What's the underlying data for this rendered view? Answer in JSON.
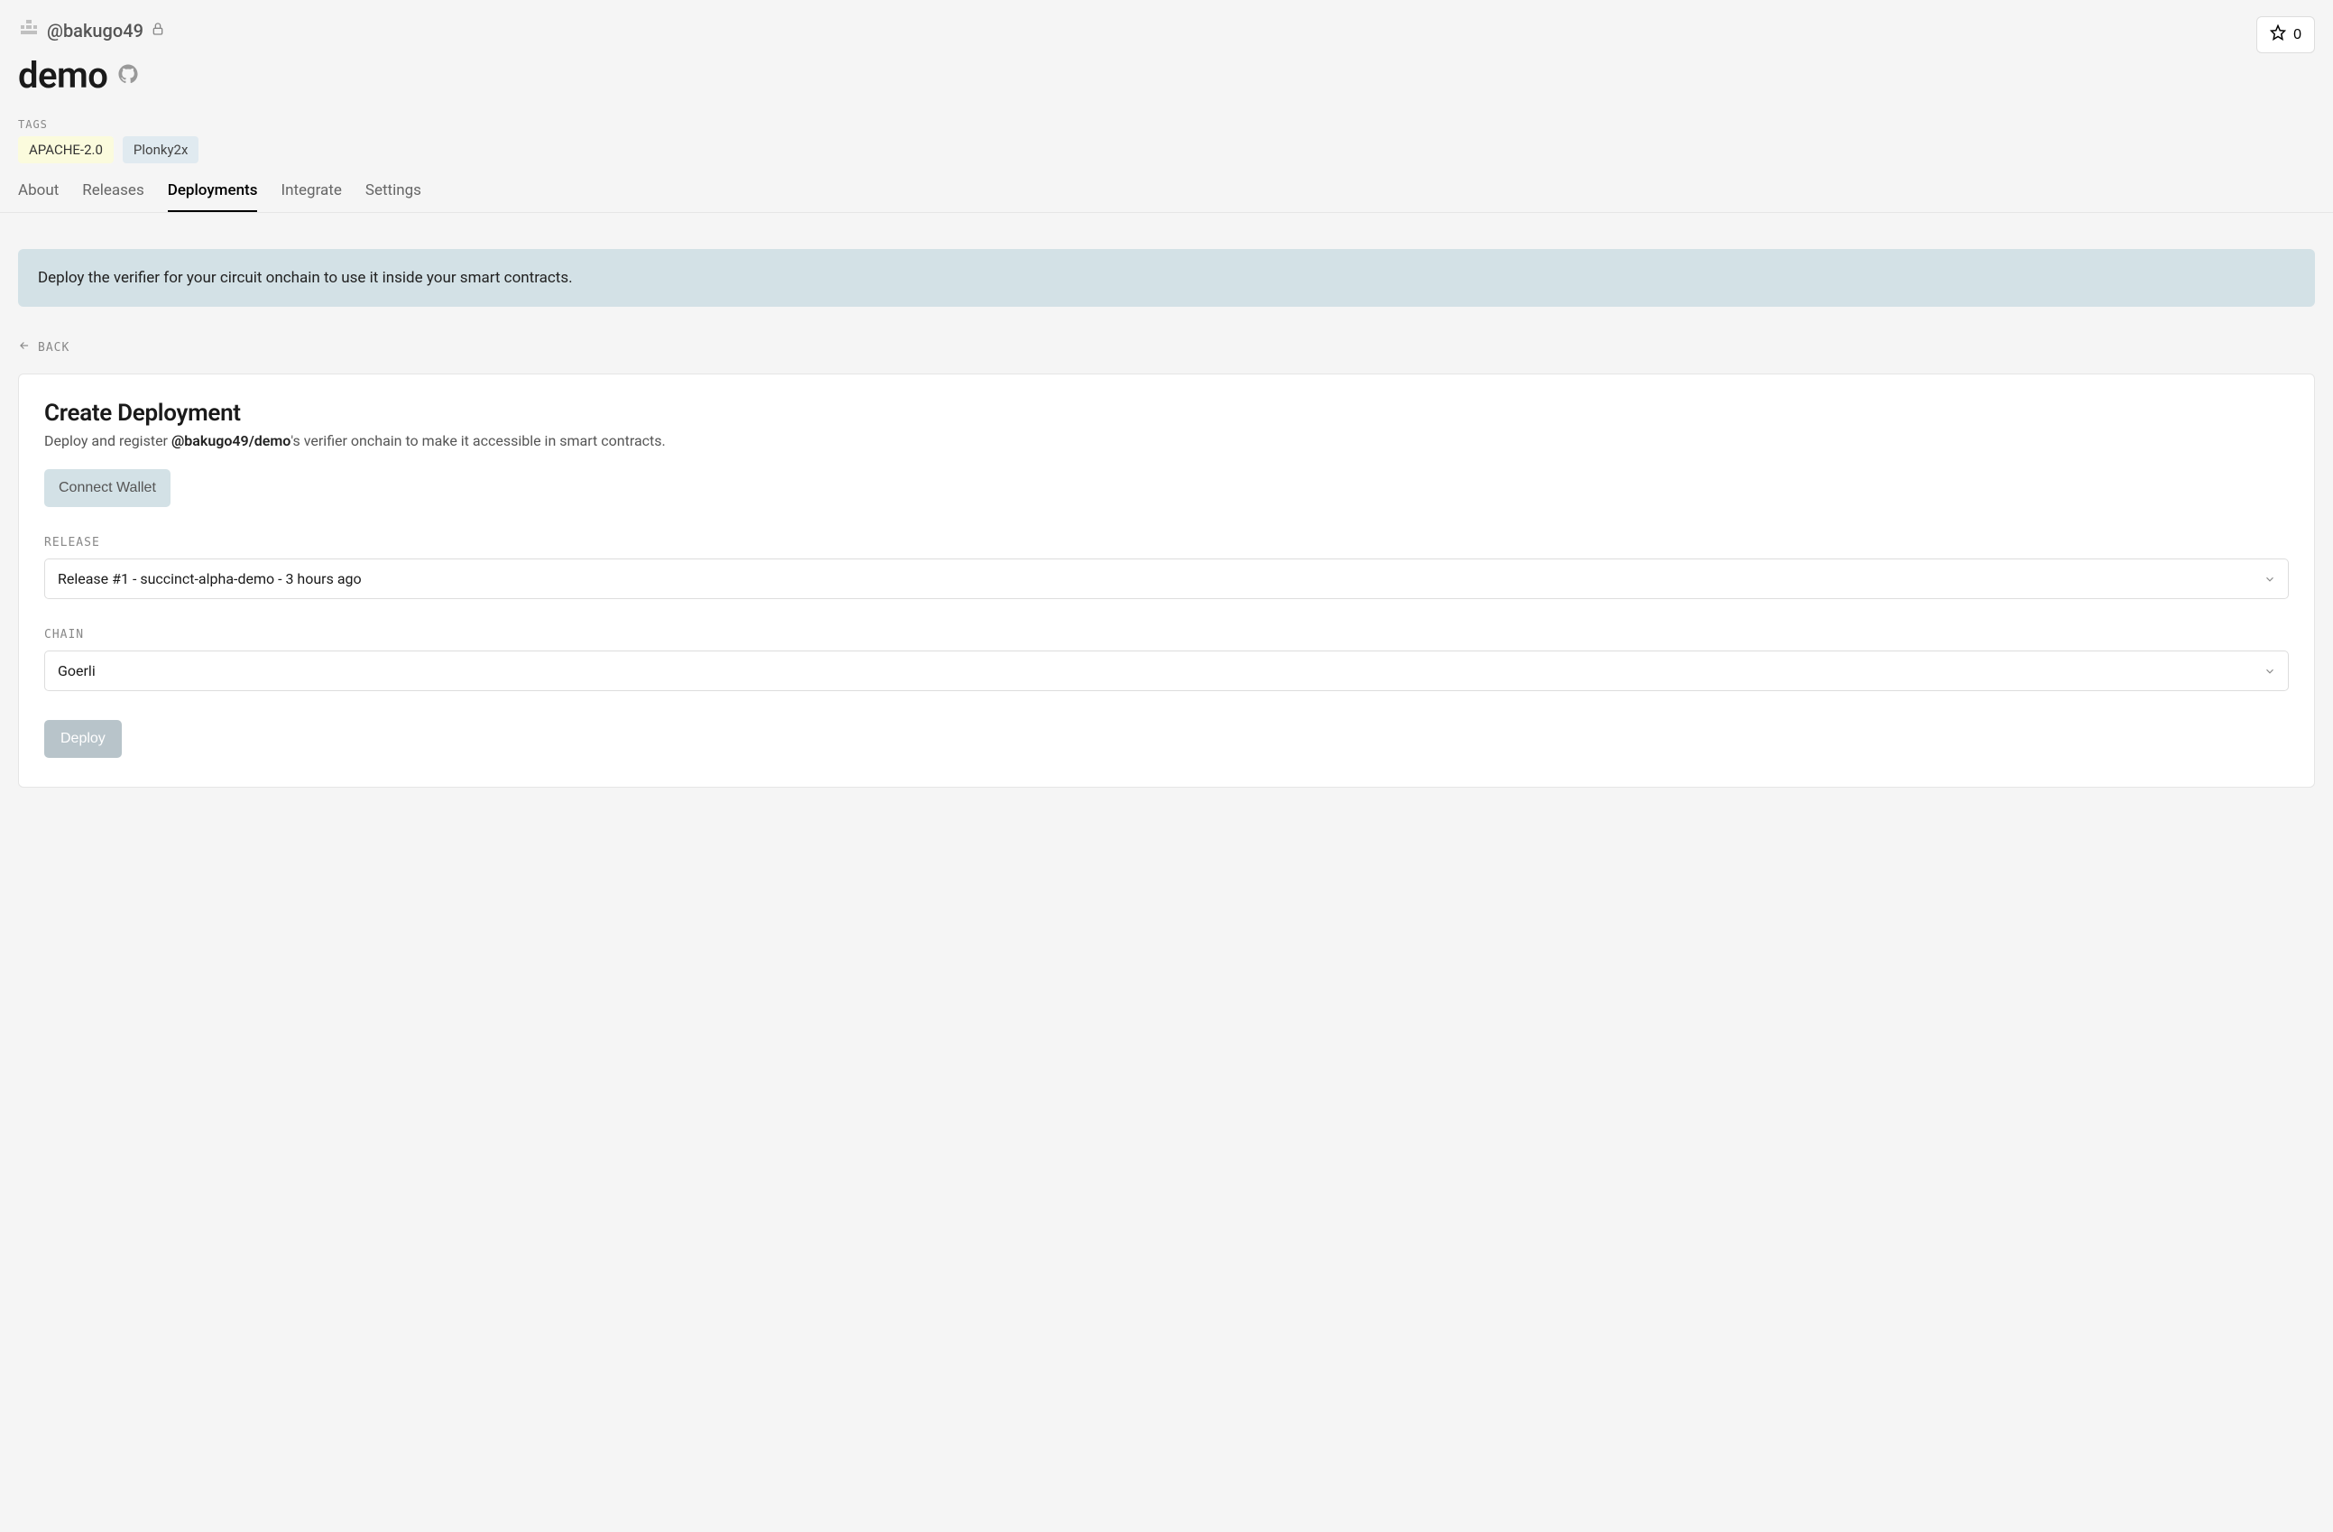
{
  "breadcrumb": {
    "user": "@bakugo49"
  },
  "star": {
    "count": "0"
  },
  "page": {
    "title": "demo"
  },
  "tags": {
    "label": "TAGS",
    "items": [
      "APACHE-2.0",
      "Plonky2x"
    ]
  },
  "tabs": {
    "about": "About",
    "releases": "Releases",
    "deployments": "Deployments",
    "integrate": "Integrate",
    "settings": "Settings"
  },
  "notice": "Deploy the verifier for your circuit onchain to use it inside your smart contracts.",
  "back": {
    "label": "BACK"
  },
  "create": {
    "title": "Create Deployment",
    "subtitle_prefix": "Deploy and register ",
    "subtitle_bold": "@bakugo49/demo",
    "subtitle_suffix": "'s verifier onchain to make it accessible in smart contracts.",
    "connect_label": "Connect Wallet",
    "release_label": "RELEASE",
    "release_value": "Release #1 - succinct-alpha-demo - 3 hours ago",
    "chain_label": "CHAIN",
    "chain_value": "Goerli",
    "deploy_label": "Deploy"
  }
}
